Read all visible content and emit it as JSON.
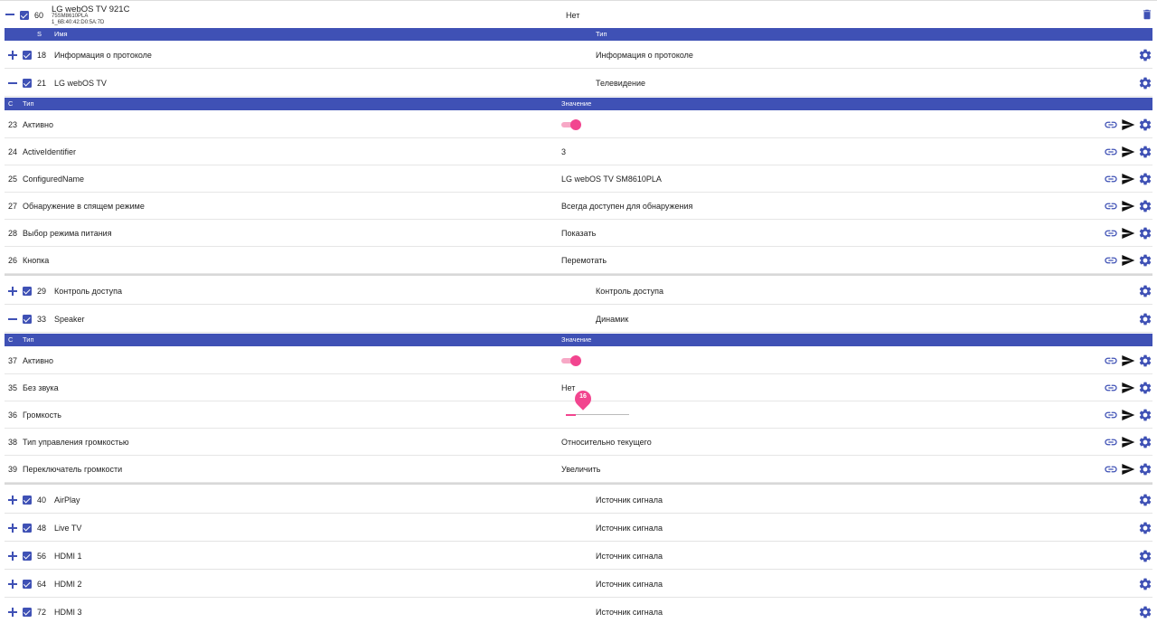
{
  "device": {
    "id": "60",
    "name": "LG webOS TV 921C",
    "model": "75SM8610PLA",
    "firmware": "1_6B:40:42:D0:5A:7D",
    "value": "Нет"
  },
  "services_header": {
    "col_s": "S",
    "col_name": "Имя",
    "col_type": "Тип"
  },
  "char_header": {
    "col_c": "C",
    "col_type": "Тип",
    "col_value": "Значение"
  },
  "services": [
    {
      "id": "18",
      "name": "Информация о протоколе",
      "type": "Информация о протоколе",
      "expanded": false
    },
    {
      "id": "21",
      "name": "LG webOS TV",
      "type": "Телевидение",
      "expanded": true,
      "chars": [
        {
          "id": "23",
          "name": "Активно",
          "value": "",
          "control": "toggle",
          "on": true
        },
        {
          "id": "24",
          "name": "ActiveIdentifier",
          "value": "3"
        },
        {
          "id": "25",
          "name": "ConfiguredName",
          "value": "LG webOS TV SM8610PLA"
        },
        {
          "id": "27",
          "name": "Обнаружение в спящем режиме",
          "value": "Всегда доступен для обнаружения"
        },
        {
          "id": "28",
          "name": "Выбор режима питания",
          "value": "Показать"
        },
        {
          "id": "26",
          "name": "Кнопка",
          "value": "Перемотать"
        }
      ]
    },
    {
      "id": "29",
      "name": "Контроль доступа",
      "type": "Контроль доступа",
      "expanded": false
    },
    {
      "id": "33",
      "name": "Speaker",
      "type": "Динамик",
      "expanded": true,
      "chars": [
        {
          "id": "37",
          "name": "Активно",
          "value": "",
          "control": "toggle",
          "on": true
        },
        {
          "id": "35",
          "name": "Без звука",
          "value": "Нет"
        },
        {
          "id": "36",
          "name": "Громкость",
          "value": "16",
          "control": "slider",
          "level_percent": 16
        },
        {
          "id": "38",
          "name": "Тип управления громкостью",
          "value": "Относительно текущего"
        },
        {
          "id": "39",
          "name": "Переключатель громкости",
          "value": "Увеличить"
        }
      ]
    },
    {
      "id": "40",
      "name": "AirPlay",
      "type": "Источник сигнала",
      "expanded": false
    },
    {
      "id": "48",
      "name": "Live TV",
      "type": "Источник сигнала",
      "expanded": false
    },
    {
      "id": "56",
      "name": "HDMI 1",
      "type": "Источник сигнала",
      "expanded": false
    },
    {
      "id": "64",
      "name": "HDMI 2",
      "type": "Источник сигнала",
      "expanded": false
    },
    {
      "id": "72",
      "name": "HDMI 3",
      "type": "Источник сигнала",
      "expanded": false
    }
  ],
  "icons": {
    "link": "link-icon",
    "send": "send-icon",
    "settings": "gear-icon",
    "delete": "trash-icon"
  },
  "colors": {
    "primary": "#3f51b5",
    "accent": "#f2458f"
  }
}
